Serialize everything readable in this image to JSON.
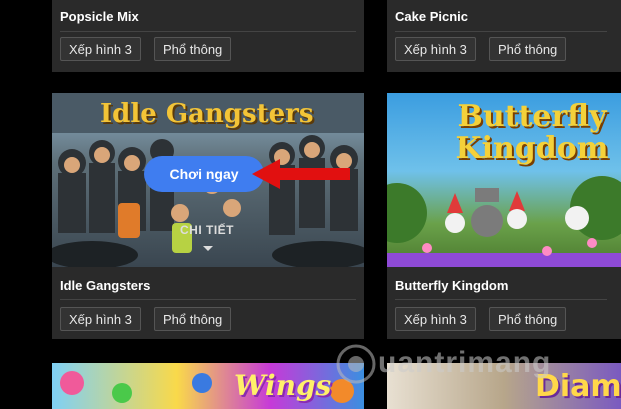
{
  "cards": [
    {
      "title": "Popsicle Mix",
      "tags": [
        "Xếp hình 3",
        "Phổ thông"
      ]
    },
    {
      "title": "Cake Picnic",
      "tags": [
        "Xếp hình 3",
        "Phổ thông"
      ]
    },
    {
      "title": "Idle Gangsters",
      "tags": [
        "Xếp hình 3",
        "Phổ thông"
      ],
      "thumb_logo": "Idle Gangsters",
      "play_label": "Chơi ngay",
      "details_label": "CHI TIẾT"
    },
    {
      "title": "Butterfly Kingdom",
      "tags": [
        "Xếp hình 3",
        "Phổ thông"
      ],
      "thumb_logo": "Butterfly Kingdom"
    }
  ],
  "bottom_thumbs": [
    {
      "logo": "Wings"
    },
    {
      "logo": "Diam"
    }
  ],
  "watermark": "uantrimang",
  "colors": {
    "accent": "#3f7df0",
    "arrow": "#e11010",
    "card_bg": "#2a2a2a"
  }
}
